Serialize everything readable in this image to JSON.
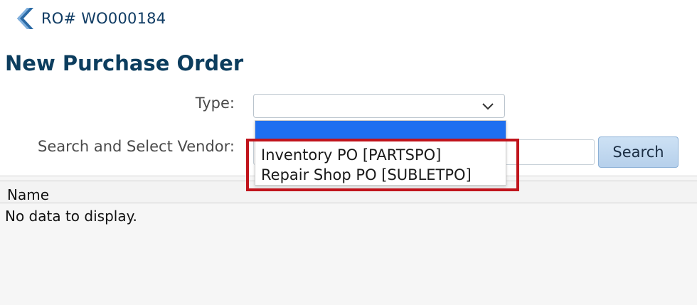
{
  "breadcrumb": {
    "label": "RO# WO000184",
    "icon": "back-chevron-icon"
  },
  "page": {
    "title": "New Purchase Order"
  },
  "form": {
    "type_label": "Type:",
    "type_value": "",
    "vendor_label": "Search and Select Vendor:",
    "vendor_value": "",
    "search_button": "Search"
  },
  "dropdown": {
    "options": [
      {
        "label": "",
        "selected": true
      },
      {
        "label": "Inventory PO [PARTSPO]",
        "selected": false
      },
      {
        "label": "Repair Shop PO [SUBLETPO]",
        "selected": false
      }
    ],
    "selected_color": "#1e6ff0"
  },
  "grid": {
    "columns": [
      "Name"
    ],
    "empty_message": "No data to display."
  },
  "colors": {
    "title": "#0c3d5e",
    "breadcrumb": "#0f3b63",
    "highlight": "#c0141c",
    "button": "#b6d0eb"
  }
}
